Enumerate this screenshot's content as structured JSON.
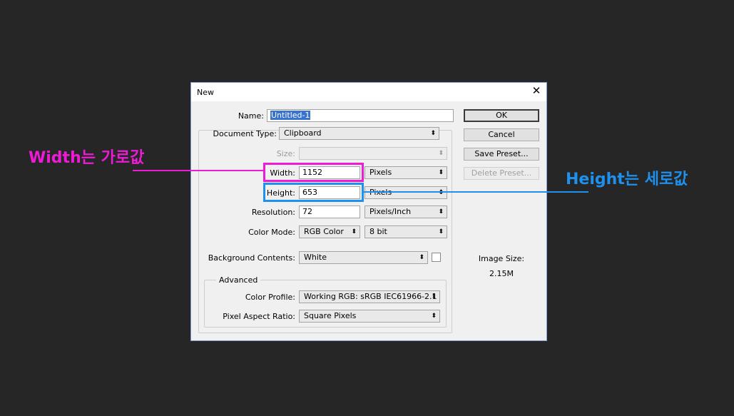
{
  "dialog": {
    "title": "New",
    "name_label": "Name:",
    "name_value": "Untitled-1",
    "document_type_label": "Document Type:",
    "document_type_value": "Clipboard",
    "size_label": "Size:",
    "width_label": "Width:",
    "width_value": "1152",
    "width_unit": "Pixels",
    "height_label": "Height:",
    "height_value": "653",
    "height_unit": "Pixels",
    "resolution_label": "Resolution:",
    "resolution_value": "72",
    "resolution_unit": "Pixels/Inch",
    "color_mode_label": "Color Mode:",
    "color_mode_value": "RGB Color",
    "bit_depth_value": "8 bit",
    "background_label": "Background Contents:",
    "background_value": "White",
    "advanced_label": "Advanced",
    "color_profile_label": "Color Profile:",
    "color_profile_value": "Working RGB:  sRGB IEC61966-2.1",
    "pixel_aspect_label": "Pixel Aspect Ratio:",
    "pixel_aspect_value": "Square Pixels",
    "image_size_label": "Image Size:",
    "image_size_value": "2.15M"
  },
  "buttons": {
    "ok": "OK",
    "cancel": "Cancel",
    "save_preset": "Save Preset...",
    "delete_preset": "Delete Preset..."
  },
  "annotations": {
    "width_note": "Width는 가로값",
    "height_note": "Height는 세로값",
    "width_color": "#ee1bd6",
    "height_color": "#1e90ee"
  },
  "icons": {
    "close": "close-icon",
    "dropdown": "chevron-updown-icon"
  }
}
